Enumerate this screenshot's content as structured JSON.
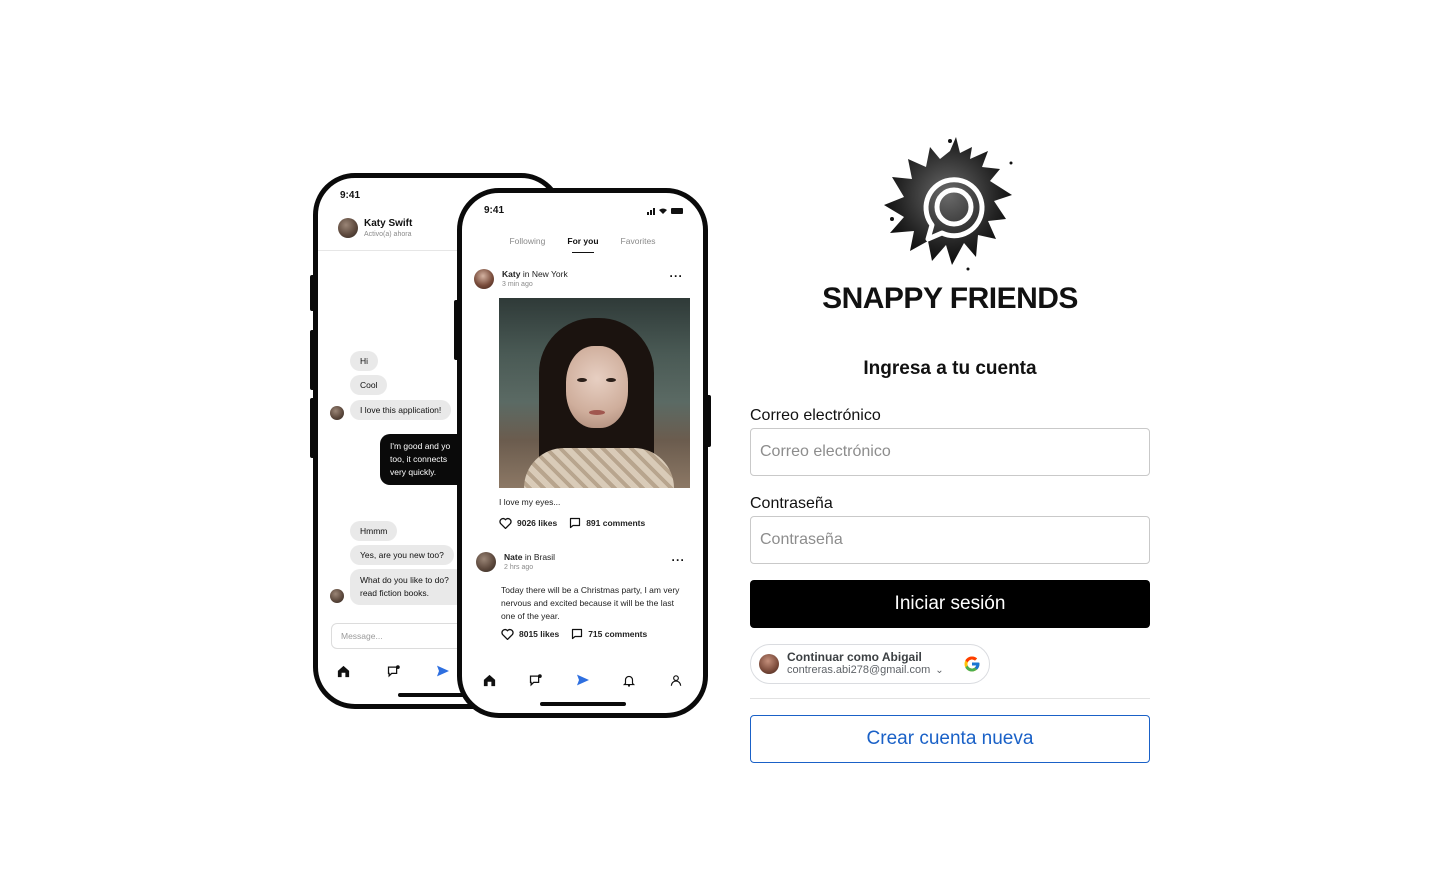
{
  "chat_phone": {
    "time": "9:41",
    "contact_name": "Katy Swift",
    "contact_status": "Activo(a) ahora",
    "messages": [
      "Hi",
      "Cool",
      "I love this application!",
      "I'm good and yo too, it connects very quickly.",
      "Hmmm",
      "Yes, are you new too?",
      "What do you like to do? read fiction books."
    ],
    "input_placeholder": "Message..."
  },
  "feed_phone": {
    "time": "9:41",
    "tabs": [
      "Following",
      "For you",
      "Favorites"
    ],
    "post1": {
      "author": "Katy",
      "location_prefix": "in",
      "location": "New York",
      "time_ago": "3 min ago",
      "caption": "I love my eyes...",
      "likes": "9026 likes",
      "comments": "891 comments"
    },
    "post2": {
      "author": "Nate",
      "location_prefix": "in",
      "location": "Brasil",
      "time_ago": "2 hrs ago",
      "caption": "Today there will be a Christmas party, I am very nervous and excited because it will be the last one of the year.",
      "likes": "8015 likes",
      "comments": "715 comments"
    }
  },
  "brand_name": "SNAPPY FRIENDS",
  "login": {
    "title": "Ingresa a tu cuenta",
    "email_label": "Correo electrónico",
    "email_placeholder": "Correo electrónico",
    "password_label": "Contraseña",
    "password_placeholder": "Contraseña",
    "submit_label": "Iniciar sesión",
    "google_name": "Continuar como Abigail",
    "google_email": "contreras.abi278@gmail.com",
    "create_account_label": "Crear cuenta nueva"
  },
  "colors": {
    "primary_button": "#000000",
    "link_blue": "#1a61c7",
    "nav_accent": "#2e6fe0"
  }
}
